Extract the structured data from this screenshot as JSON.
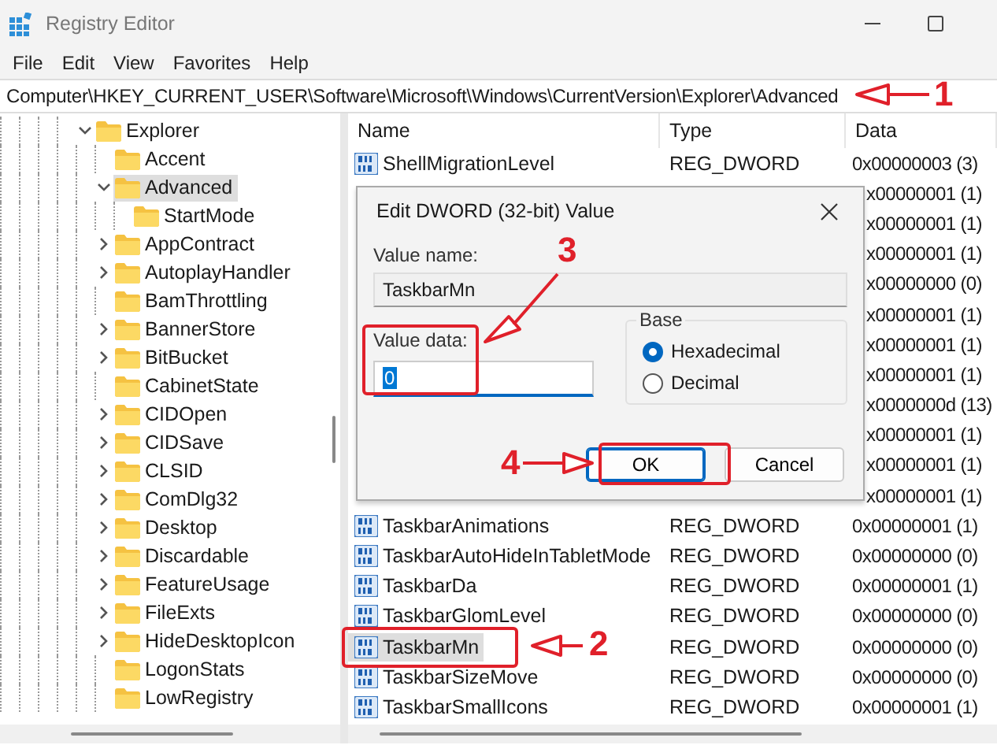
{
  "window": {
    "title": "Registry Editor"
  },
  "menu": [
    "File",
    "Edit",
    "View",
    "Favorites",
    "Help"
  ],
  "address": "Computer\\HKEY_CURRENT_USER\\Software\\Microsoft\\Windows\\CurrentVersion\\Explorer\\Advanced",
  "tree": [
    {
      "label": "Explorer",
      "expandable": true,
      "expanded": true,
      "selected": false,
      "children": [
        {
          "label": "Accent",
          "expandable": false,
          "selected": false
        },
        {
          "label": "Advanced",
          "expandable": true,
          "expanded": true,
          "selected": true,
          "children": [
            {
              "label": "StartMode",
              "expandable": false,
              "selected": false
            }
          ]
        },
        {
          "label": "AppContract",
          "expandable": true,
          "expanded": false,
          "selected": false
        },
        {
          "label": "AutoplayHandler",
          "expandable": true,
          "expanded": false,
          "selected": false
        },
        {
          "label": "BamThrottling",
          "expandable": false,
          "selected": false
        },
        {
          "label": "BannerStore",
          "expandable": true,
          "expanded": false,
          "selected": false
        },
        {
          "label": "BitBucket",
          "expandable": true,
          "expanded": false,
          "selected": false
        },
        {
          "label": "CabinetState",
          "expandable": false,
          "selected": false
        },
        {
          "label": "CIDOpen",
          "expandable": true,
          "expanded": false,
          "selected": false
        },
        {
          "label": "CIDSave",
          "expandable": true,
          "expanded": false,
          "selected": false
        },
        {
          "label": "CLSID",
          "expandable": true,
          "expanded": false,
          "selected": false
        },
        {
          "label": "ComDlg32",
          "expandable": true,
          "expanded": false,
          "selected": false
        },
        {
          "label": "Desktop",
          "expandable": true,
          "expanded": false,
          "selected": false
        },
        {
          "label": "Discardable",
          "expandable": true,
          "expanded": false,
          "selected": false
        },
        {
          "label": "FeatureUsage",
          "expandable": true,
          "expanded": false,
          "selected": false
        },
        {
          "label": "FileExts",
          "expandable": true,
          "expanded": false,
          "selected": false
        },
        {
          "label": "HideDesktopIcon",
          "expandable": true,
          "expanded": false,
          "selected": false
        },
        {
          "label": "LogonStats",
          "expandable": false,
          "selected": false
        },
        {
          "label": "LowRegistry",
          "expandable": false,
          "selected": false
        }
      ]
    }
  ],
  "table": {
    "columns": [
      "Name",
      "Type",
      "Data"
    ],
    "rows": [
      {
        "name": "ShellMigrationLevel",
        "type": "REG_DWORD",
        "data": "0x00000003 (3)",
        "selected": false
      },
      {
        "data": "x00000001 (1)"
      },
      {
        "data": "x00000001 (1)"
      },
      {
        "data": "x00000001 (1)"
      },
      {
        "data": "x00000000 (0)"
      },
      {
        "data": "x00000001 (1)"
      },
      {
        "data": "x00000001 (1)"
      },
      {
        "data": "x00000001 (1)"
      },
      {
        "data": "x0000000d (13)"
      },
      {
        "data": "x00000001 (1)"
      },
      {
        "data": "x00000001 (1)"
      },
      {
        "data": "x00000001 (1)"
      },
      {
        "name": "TaskbarAnimations",
        "type": "REG_DWORD",
        "data": "0x00000001 (1)",
        "selected": false
      },
      {
        "name": "TaskbarAutoHideInTabletMode",
        "type": "REG_DWORD",
        "data": "0x00000000 (0)",
        "selected": false
      },
      {
        "name": "TaskbarDa",
        "type": "REG_DWORD",
        "data": "0x00000001 (1)",
        "selected": false
      },
      {
        "name": "TaskbarGlomLevel",
        "type": "REG_DWORD",
        "data": "0x00000000 (0)",
        "selected": false
      },
      {
        "name": "TaskbarMn",
        "type": "REG_DWORD",
        "data": "0x00000000 (0)",
        "selected": true
      },
      {
        "name": "TaskbarSizeMove",
        "type": "REG_DWORD",
        "data": "0x00000000 (0)",
        "selected": false
      },
      {
        "name": "TaskbarSmallIcons",
        "type": "REG_DWORD",
        "data": "0x00000001 (1)",
        "selected": false
      }
    ]
  },
  "dialog": {
    "title": "Edit DWORD (32-bit) Value",
    "value_name_label": "Value name:",
    "value_name": "TaskbarMn",
    "value_data_label": "Value data:",
    "value_data": "0",
    "base_label": "Base",
    "base_options": [
      {
        "label": "Hexadecimal",
        "selected": true
      },
      {
        "label": "Decimal",
        "selected": false
      }
    ],
    "buttons": [
      {
        "label": "OK",
        "default": true
      },
      {
        "label": "Cancel",
        "default": false
      }
    ]
  },
  "annotations": [
    {
      "label": "1"
    },
    {
      "label": "2"
    },
    {
      "label": "3"
    },
    {
      "label": "4"
    }
  ]
}
